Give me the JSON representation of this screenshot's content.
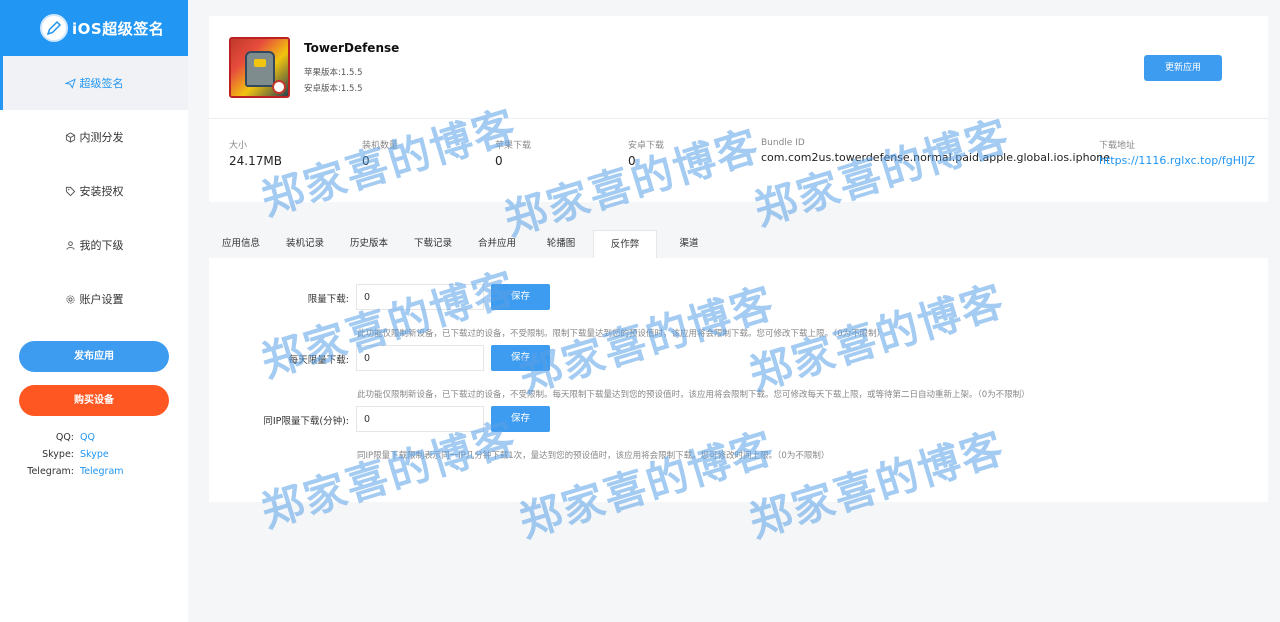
{
  "brand": {
    "title": "iOS超级签名",
    "icon": "pen-icon"
  },
  "sidebar": {
    "items": [
      {
        "label": "超级签名",
        "icon": "paper-plane-icon",
        "active": true
      },
      {
        "label": "内测分发",
        "icon": "cube-icon"
      },
      {
        "label": "安装授权",
        "icon": "tag-icon"
      },
      {
        "label": "我的下级",
        "icon": "user-icon"
      },
      {
        "label": "账户设置",
        "icon": "gear-icon"
      }
    ],
    "publish_label": "发布应用",
    "buy_label": "购买设备",
    "contacts": [
      {
        "label": "QQ:",
        "value": "QQ"
      },
      {
        "label": "Skype:",
        "value": "Skype"
      },
      {
        "label": "Telegram:",
        "value": "Telegram"
      }
    ]
  },
  "app": {
    "name": "TowerDefense",
    "ios_version": "苹果版本:1.5.5",
    "android_version": "安卓版本:1.5.5",
    "update_label": "更新应用"
  },
  "stats": {
    "size": {
      "label": "大小",
      "value": "24.17MB"
    },
    "installs": {
      "label": "装机数量",
      "value": "0"
    },
    "apple_downloads": {
      "label": "苹果下载",
      "value": "0"
    },
    "android_downloads": {
      "label": "安卓下载",
      "value": "0"
    },
    "bundle": {
      "label": "Bundle ID",
      "value": "com.com2us.towerdefense.normal.paid.apple.global.ios.iphone"
    },
    "download": {
      "label": "下载地址",
      "value": "https://1116.rglxc.top/fgHIJZ"
    }
  },
  "tabs": [
    "应用信息",
    "装机记录",
    "历史版本",
    "下载记录",
    "合并应用",
    "轮播图",
    "反作弊",
    "渠道"
  ],
  "active_tab": "反作弊",
  "form": {
    "limit_label": "限量下载:",
    "limit_value": "0",
    "limit_help": "此功能仅限制新设备，已下载过的设备，不受限制。限制下载量达到您的预设值时，该应用将会限制下载。您可修改下载上限。（0为不限制）",
    "daily_label": "每天限量下载:",
    "daily_value": "0",
    "daily_help": "此功能仅限制新设备，已下载过的设备，不受限制。每天限制下载量达到您的预设值时，该应用将会限制下载。您可修改每天下载上限，或等待第二日自动重新上架。（0为不限制）",
    "ip_label": "同IP限量下载(分钟):",
    "ip_value": "0",
    "ip_help": "同IP限量下载限制表示同一IP几分钟下载1次，量达到您的预设值时，该应用将会限制下载。您可修改时间上限。（0为不限制）",
    "save_label": "保存"
  },
  "watermark": "郑家喜的博客",
  "colors": {
    "accent": "#2196f3",
    "buy": "#ff5722",
    "watermark": "#5aa0e6"
  }
}
